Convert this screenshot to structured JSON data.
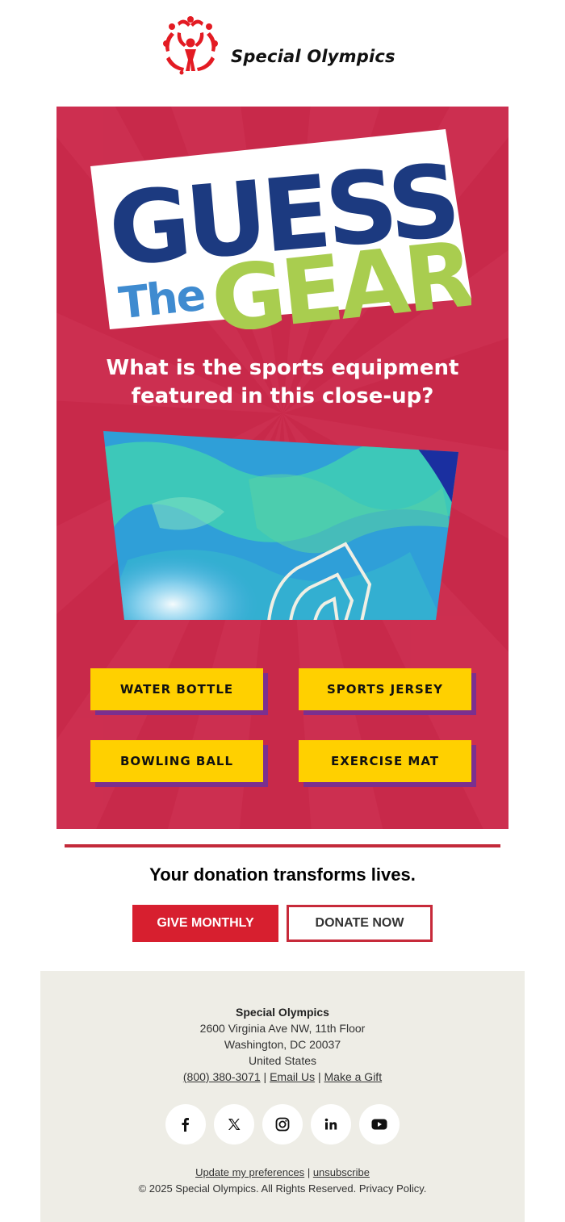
{
  "header": {
    "logo_text": "Special Olympics",
    "logo_color": "#e31b23"
  },
  "hero": {
    "background_color": "#c8294a",
    "title": {
      "line1": "GUESS",
      "line2_small": "The",
      "line2_large": "GEAR",
      "colors": {
        "guess": "#1c3a80",
        "the": "#3f8bd0",
        "gear": "#a9cd4f"
      }
    },
    "question_line1": "What is the sports equipment",
    "question_line2": "featured in this close-up?",
    "answers": [
      {
        "label": "WATER BOTTLE"
      },
      {
        "label": "SPORTS JERSEY"
      },
      {
        "label": "BOWLING BALL"
      },
      {
        "label": "EXERCISE MAT"
      }
    ],
    "answer_colors": {
      "fill": "#ffd000",
      "shadow": "#7b2f8f"
    }
  },
  "donation": {
    "heading": "Your donation transforms lives.",
    "give_monthly_label": "GIVE MONTHLY",
    "donate_now_label": "DONATE NOW"
  },
  "footer": {
    "org": "Special Olympics",
    "address_line1": "2600 Virginia Ave NW, 11th Floor",
    "address_line2": "Washington, DC 20037",
    "address_line3": "United States",
    "phone": "(800) 380-3071",
    "email_link": "Email Us",
    "gift_link": "Make a Gift",
    "separator": "|",
    "social": [
      {
        "icon": "facebook-icon"
      },
      {
        "icon": "x-icon"
      },
      {
        "icon": "instagram-icon"
      },
      {
        "icon": "linkedin-icon"
      },
      {
        "icon": "youtube-icon"
      }
    ],
    "preferences_link": "Update my preferences",
    "unsubscribe_link": "unsubscribe",
    "copyright": "© 2025 Special Olympics. All Rights Reserved. Privacy Policy."
  }
}
